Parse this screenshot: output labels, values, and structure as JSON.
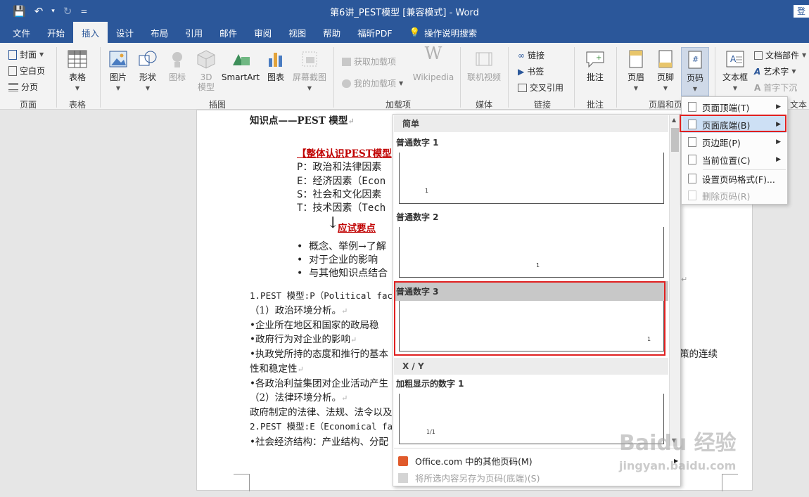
{
  "titlebar": {
    "title": "第6讲_PEST模型 [兼容模式] - Word",
    "login": "登",
    "qat": {
      "save": "💾",
      "undo": "↶",
      "undo_caret": "▾",
      "redo": "↻",
      "customize": "="
    }
  },
  "tabs": [
    "文件",
    "开始",
    "插入",
    "设计",
    "布局",
    "引用",
    "邮件",
    "审阅",
    "视图",
    "帮助",
    "福昕PDF",
    "💡",
    "操作说明搜索"
  ],
  "ribbon": {
    "pages": {
      "cover": "封面",
      "blank": "空白页",
      "break": "分页",
      "label": "页面"
    },
    "tables": {
      "table": "表格",
      "label": "表格"
    },
    "illustrations": {
      "picture": "图片",
      "shapes": "形状",
      "icons": "图标",
      "model3d": "3D 模型",
      "smartart": "SmartArt",
      "chart": "图表",
      "screenshot": "屏幕截图",
      "label": "插图"
    },
    "addins": {
      "get": "获取加载项",
      "my": "我的加载项",
      "wiki": "Wikipedia",
      "label": "加载项"
    },
    "media": {
      "video": "联机视频",
      "label": "媒体"
    },
    "links": {
      "link": "链接",
      "bookmark": "书签",
      "crossref": "交叉引用",
      "label": "链接"
    },
    "comments": {
      "comment": "批注",
      "label": "批注"
    },
    "headerfooter": {
      "header": "页眉",
      "footer": "页脚",
      "pagenum": "页码",
      "label": "页眉和页"
    },
    "text": {
      "textbox": "文本框",
      "parts": "文档部件",
      "wordart": "艺术字",
      "dropcap": "首字下沉",
      "label": "文本"
    }
  },
  "document": {
    "heading": "知识点——PEST 模型",
    "red_heading": "【整体认识PEST模型",
    "p": "P：政治和法律因素",
    "e": "E：经济因素（Econ",
    "s": "S：社会和文化因素",
    "t": "T：技术因素（Tech",
    "arrow": "↓",
    "exam": "应试要点",
    "bullet1": "概念、举例→了解",
    "bullet2": "对于企业的影响",
    "bullet3": "与其他知识点结合",
    "l1": "1.PEST 模型:P（Political fact",
    "l2": "（1）政治环境分析。",
    "l3": "企业所在地区和国家的政局稳",
    "l4": "政府行为对企业的影响",
    "l5": "执政党所持的态度和推行的基本",
    "l5b": "策的连续",
    "l6": "性和稳定性",
    "l7": "各政治利益集团对企业活动产生",
    "l8": "（2）法律环境分析。",
    "l9": "政府制定的法律、法规、法令以及",
    "l10": "2.PEST 模型:E（Economical fact",
    "l11": "社会经济结构：产业结构、分配",
    "para_mark": "↵",
    "bullet_mark": "•"
  },
  "gallery": {
    "section_simple": "简单",
    "item1": "普通数字 1",
    "item2": "普通数字 2",
    "item3": "普通数字 3",
    "section_xy": "X / Y",
    "item4": "加粗显示的数字 1",
    "num1": "1",
    "num2": "1",
    "num3": "1",
    "num4": "1/1",
    "more": "Office.com 中的其他页码(M)",
    "save": "将所选内容另存为页码(底端)(S)"
  },
  "menu": {
    "top": "页面顶端(T)",
    "bottom": "页面底端(B)",
    "margin": "页边距(P)",
    "current": "当前位置(C)",
    "format": "设置页码格式(F)...",
    "remove": "删除页码(R)"
  },
  "watermark": {
    "brand": "Baidu 经验",
    "url": "jingyan.baidu.com"
  },
  "colors": {
    "accent": "#2b579a",
    "highlight": "#e02020",
    "title_red": "#c00000"
  }
}
